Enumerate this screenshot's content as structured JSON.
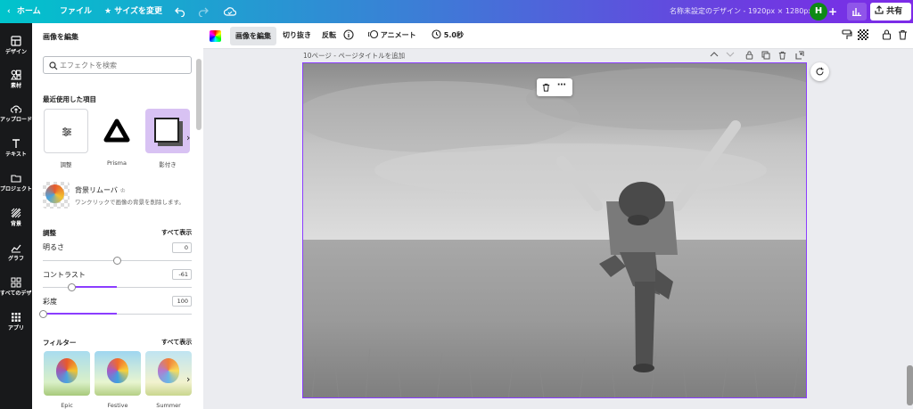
{
  "topbar": {
    "home": "ホーム",
    "file": "ファイル",
    "resize": "サイズを変更",
    "doc_title": "名称未設定のデザイン - 1920px × 1280px",
    "avatar": "H",
    "share": "共有"
  },
  "rail": [
    {
      "label": "デザイン",
      "icon": "layout-icon"
    },
    {
      "label": "素材",
      "icon": "shapes-icon"
    },
    {
      "label": "アップロード",
      "icon": "upload-cloud-icon"
    },
    {
      "label": "テキスト",
      "icon": "text-icon"
    },
    {
      "label": "プロジェクト",
      "icon": "folder-icon"
    },
    {
      "label": "背景",
      "icon": "pattern-icon"
    },
    {
      "label": "グラフ",
      "icon": "chart-icon"
    },
    {
      "label": "すべてのデザ...",
      "icon": "grid-icon"
    },
    {
      "label": "アプリ",
      "icon": "apps-icon"
    }
  ],
  "panel": {
    "title": "画像を編集",
    "search_placeholder": "エフェクトを検索",
    "recent_title": "最近使用した項目",
    "recent": [
      {
        "label": "調整"
      },
      {
        "label": "Prisma"
      },
      {
        "label": "影付き"
      }
    ],
    "bg_remover": {
      "title": "背景リムーバ",
      "desc": "ワンクリックで画像の背景を削除します。"
    },
    "adjust_title": "調整",
    "show_all": "すべて表示",
    "sliders": [
      {
        "label": "明るさ",
        "value": "0",
        "level": 0
      },
      {
        "label": "コントラスト",
        "value": "-61",
        "level": -61
      },
      {
        "label": "彩度",
        "value": "100",
        "level": 100
      }
    ],
    "filters_title": "フィルター",
    "filters_show_all": "すべて表示",
    "filters": [
      {
        "label": "Epic"
      },
      {
        "label": "Festive"
      },
      {
        "label": "Summer"
      }
    ]
  },
  "toolbar": {
    "edit_image": "画像を編集",
    "crop": "切り抜き",
    "flip": "反転",
    "animate": "アニメート",
    "duration": "5.0秒"
  },
  "page": {
    "label": "10ページ - ページタイトルを追加"
  },
  "colors": {
    "accent": "#8b3dff",
    "rail_bg": "#18191b",
    "avatar_bg": "#0e8a16"
  }
}
